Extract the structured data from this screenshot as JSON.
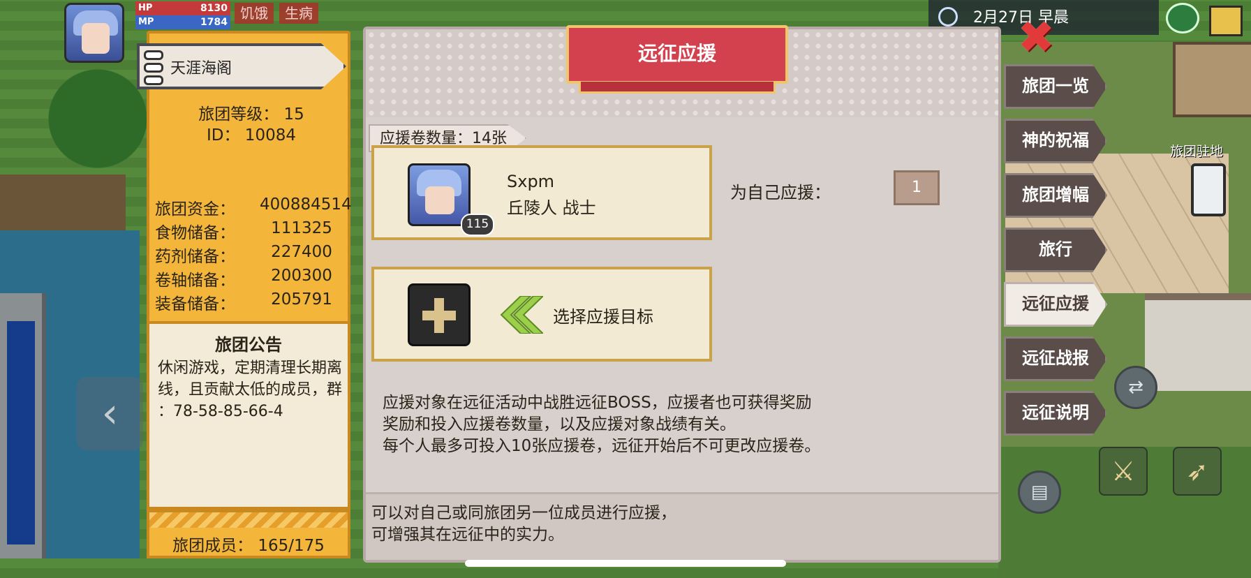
{
  "hud": {
    "hp_label": "HP",
    "hp_value": "8130",
    "mp_label": "MP",
    "mp_value": "1784",
    "status_hungry": "饥饿",
    "status_sick": "生病",
    "date": "2月27日 早晨"
  },
  "guild": {
    "name": "天涯海阁",
    "level": "旅团等级：  15",
    "id": "ID：  10084",
    "resources": [
      {
        "label": "旅团资金：",
        "value": "400884514"
      },
      {
        "label": "食物储备：",
        "value": "111325"
      },
      {
        "label": "药剂储备：",
        "value": "227400"
      },
      {
        "label": "卷轴储备：",
        "value": "200300"
      },
      {
        "label": "装备储备：",
        "value": "205791"
      }
    ],
    "notice_title": "旅团公告",
    "notice_body": "休闲游戏，定期清理长期离线，且贡献太低的成员，群\n：78-58-85-66-4",
    "members": "旅团成员：  165/175"
  },
  "dialog": {
    "title": "远征应援",
    "ticket_count": "应援卷数量：14张",
    "self_card": {
      "name": "Sxpm",
      "class": "丘陵人 战士",
      "level": "115"
    },
    "self_support_label": "为自己应援：",
    "self_support_value": "1",
    "select_target_label": "选择应援目标",
    "description": "应援对象在远征活动中战胜远征BOSS，应援者也可获得奖励\n奖励和投入应援卷数量，以及应援对象战绩有关。\n每个人最多可投入10张应援卷，远征开始后不可更改应援卷。",
    "bottom_note": "可以对自己或同旅团另一位成员进行应援，\n可增强其在远征中的实力。"
  },
  "tabs": [
    {
      "label": "旅团一览",
      "active": false
    },
    {
      "label": "神的祝福",
      "active": false
    },
    {
      "label": "旅团增幅",
      "active": false
    },
    {
      "label": "旅行",
      "active": false
    },
    {
      "label": "远征应援",
      "active": true
    },
    {
      "label": "远征战报",
      "active": false
    },
    {
      "label": "远征说明",
      "active": false
    }
  ],
  "map": {
    "station_label": "旅团驻地"
  },
  "colors": {
    "guild_panel": "#f3b63b",
    "title_banner": "#d3404e",
    "active_tab": "#f1ebe6",
    "inactive_tab": "#5a4d4a"
  }
}
